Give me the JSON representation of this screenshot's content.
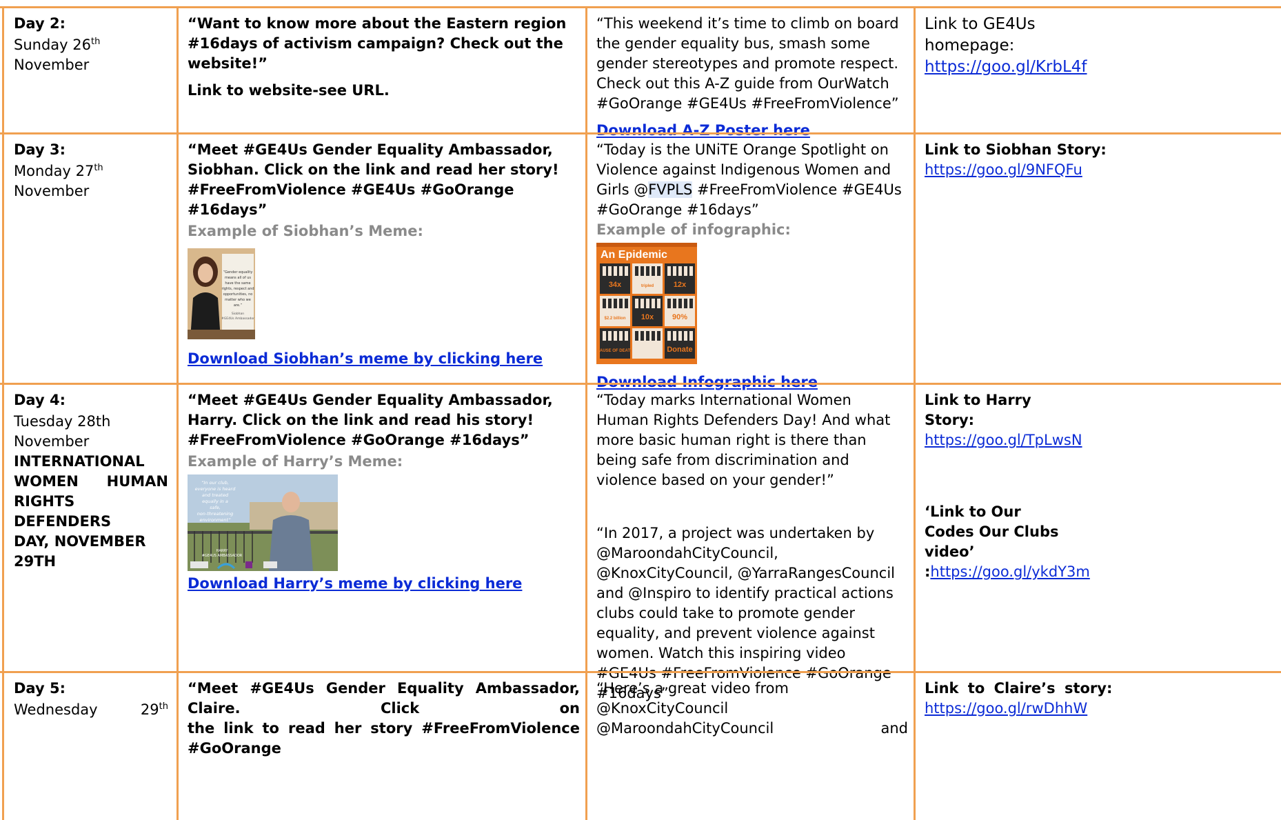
{
  "row2": {
    "day": "Day 2:",
    "date": "Sunday 26",
    "date_sup": "th",
    "date_tail": " November",
    "post1": "“Want to know more about the Eastern region #16days of activism campaign? Check out the website!”",
    "post1_link": "Link to website-see URL.",
    "post2": "“This weekend it’s time to climb on board the gender equality bus, smash some gender stereotypes and promote respect. Check out this A-Z guide from OurWatch #GoOrange #GE4Us #FreeFromViolence”",
    "post2_link": "Download A-Z Poster here",
    "link_label": "Link to GE4Us homepage:",
    "link_url": "https://goo.gl/KrbL4f"
  },
  "row3": {
    "day": "Day 3:",
    "date": "Monday 27",
    "date_sup": "th",
    "date_tail": " November",
    "post1": "“Meet #GE4Us Gender Equality Ambassador, Siobhan. Click on the link and read her story! #FreeFromViolence #GE4Us #GoOrange #16days”",
    "example_label": "Example of Siobhan’s Meme:",
    "meme_quote": "“Gender equality means all of us have the same rights, respect and opportunities, no matter who we are.”",
    "meme_sign": "Siobhan #GE4Us Ambassador",
    "post1_link": "Download Siobhan’s meme by clicking here",
    "post2_a": "“Today is the UNiTE Orange Spotlight on Violence against Indigenous Women and Girls @",
    "post2_hl": "FVPLS",
    "post2_b": " #FreeFromViolence #GE4Us #GoOrange #16days”",
    "infographic_label": "Example of infographic:",
    "infographic_title": "An Epidemic",
    "info_tiles": [
      "34x",
      "tripled",
      "12x",
      "$2.2 billion",
      "10x",
      "90%",
      "CAUSE OF DEATH",
      "",
      "Donate"
    ],
    "post2_link": "Download Infographic here",
    "link_label": "Link to Siobhan Story:",
    "link_url": "https://goo.gl/9NFQFu"
  },
  "row4": {
    "day": "Day 4:",
    "date": "Tuesday 28th November",
    "event_l1": "INTERNATIONAL",
    "event_l2": "WOMEN HUMAN",
    "event_l3": "RIGHTS DEFENDERS",
    "event_l4": "DAY, NOVEMBER 29TH",
    "post1": " “Meet #GE4Us Gender Equality Ambassador, Harry. Click on the link and read his story! #FreeFromViolence #GoOrange #16days”",
    "example_label": "Example of Harry’s Meme:",
    "meme_quote": "“In our club, everyone is heard and treated equally in a safe, non-threatening environment”",
    "meme_sign": "HARRY #GE4US AMBASSADOR",
    "post1_link": "Download Harry’s meme by clicking here",
    "post2": "“Today marks International Women Human Rights Defenders Day! And what more basic human right is there than being safe from discrimination and violence based on your gender!”",
    "post3": "“In 2017, a project was undertaken by @MaroondahCityCouncil, @KnoxCityCouncil, @YarraRangesCouncil and @Inspiro to identify practical actions clubs could take to promote gender equality, and prevent violence against women. Watch this inspiring video #GE4Us #FreeFromViolence #GoOrange #16days”",
    "link1_label": "Link to Harry Story:",
    "link1_url": "https://goo.gl/TpLwsN",
    "link2_label": "‘Link to Our Codes Our Clubs video’",
    "link2_prefix": ":",
    "link2_url": "https://goo.gl/ykdY3m"
  },
  "row5": {
    "day": "Day 5:",
    "date": "Wednesday",
    "date_num": "29",
    "date_sup": "th",
    "post1_l1": "“Meet #GE4Us Gender Equality Ambassador, Claire. Click on",
    "post1_l2": "the link to read her story #FreeFromViolence #GoOrange",
    "post2_l1": "“Here’s a great video from @KnoxCityCouncil",
    "post2_l2a": "@MaroondahCityCouncil",
    "post2_l2b": "and",
    "link_label": "Link to Claire’s story:",
    "link_url": "https://goo.gl/rwDhhW"
  },
  "colors": {
    "border": "#F0A050",
    "link": "#0b2bd6",
    "muted": "#8a8a8a"
  }
}
